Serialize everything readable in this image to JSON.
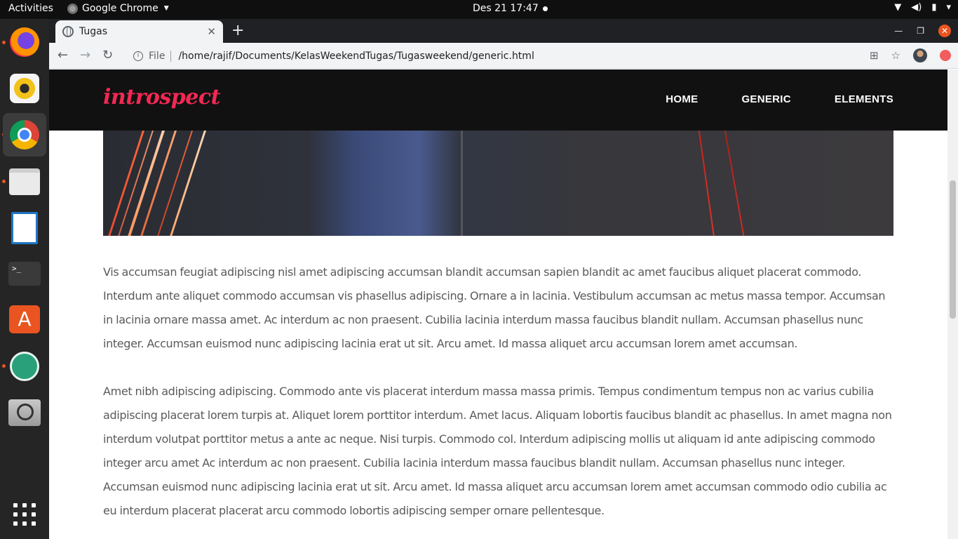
{
  "system": {
    "activities": "Activities",
    "app_menu": "Google Chrome",
    "clock": "Des 21  17:47"
  },
  "dock": {
    "apps": [
      "firefox-icon",
      "rhythmbox-icon",
      "chrome-icon",
      "files-icon",
      "libreoffice-writer-icon",
      "terminal-icon",
      "software-store-icon",
      "atom-icon",
      "screenshot-icon"
    ]
  },
  "browser": {
    "tab_title": "Tugas",
    "scheme_label": "File",
    "url": "/home/rajif/Documents/KelasWeekendTugas/Tugasweekend/generic.html"
  },
  "site": {
    "logo": "introspect",
    "nav": {
      "home": "HOME",
      "generic": "GENERIC",
      "elements": "ELEMENTS"
    },
    "paragraphs": [
      "Vis accumsan feugiat adipiscing nisl amet adipiscing accumsan blandit accumsan sapien blandit ac amet faucibus aliquet placerat commodo. Interdum ante aliquet commodo accumsan vis phasellus adipiscing. Ornare a in lacinia. Vestibulum accumsan ac metus massa tempor. Accumsan in lacinia ornare massa amet. Ac interdum ac non praesent. Cubilia lacinia interdum massa faucibus blandit nullam. Accumsan phasellus nunc integer. Accumsan euismod nunc adipiscing lacinia erat ut sit. Arcu amet. Id massa aliquet arcu accumsan lorem amet accumsan.",
      "Amet nibh adipiscing adipiscing. Commodo ante vis placerat interdum massa massa primis. Tempus condimentum tempus non ac varius cubilia adipiscing placerat lorem turpis at. Aliquet lorem porttitor interdum. Amet lacus. Aliquam lobortis faucibus blandit ac phasellus. In amet magna non interdum volutpat porttitor metus a ante ac neque. Nisi turpis. Commodo col. Interdum adipiscing mollis ut aliquam id ante adipiscing commodo integer arcu amet Ac interdum ac non praesent. Cubilia lacinia interdum massa faucibus blandit nullam. Accumsan phasellus nunc integer. Accumsan euismod nunc adipiscing lacinia erat ut sit. Arcu amet. Id massa aliquet arcu accumsan lorem amet accumsan commodo odio cubilia ac eu interdum placerat placerat arcu commodo lobortis adipiscing semper ornare pellentesque."
    ]
  },
  "colors": {
    "logo": "#f32853",
    "header_bg": "#111111",
    "ubuntu_orange": "#e95420"
  }
}
